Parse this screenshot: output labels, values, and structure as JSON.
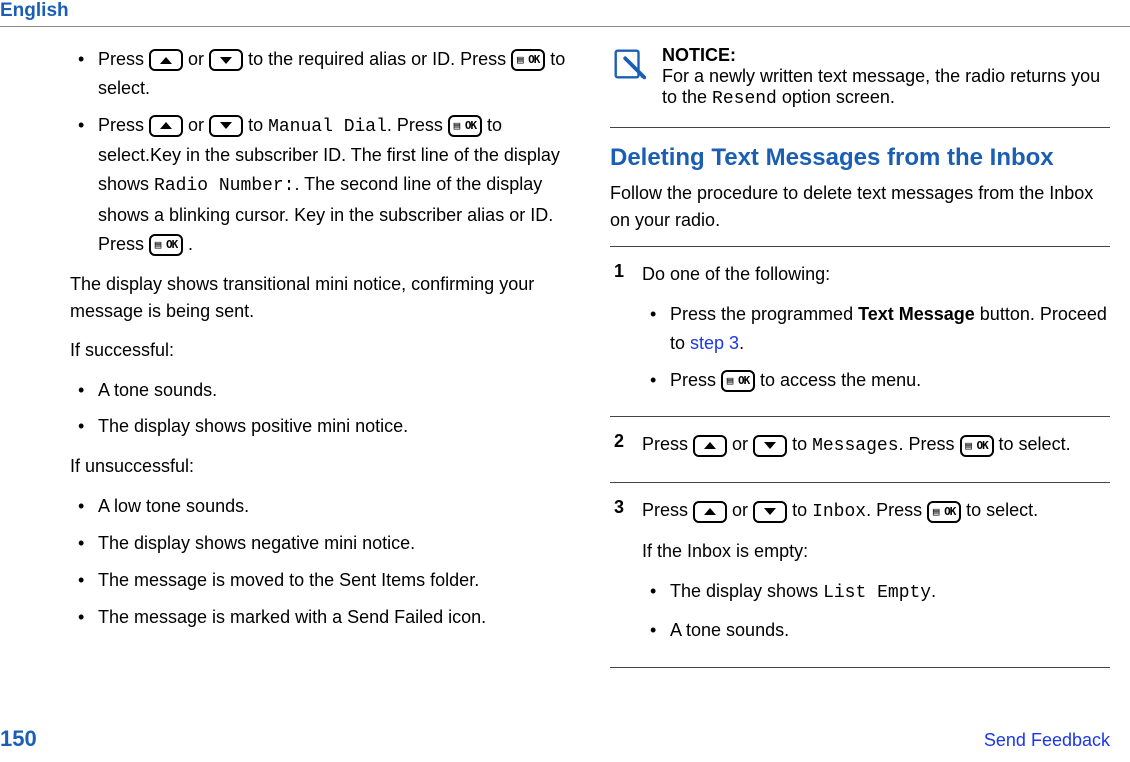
{
  "header": {
    "language": "English"
  },
  "left": {
    "bullet1_a": "Press ",
    "bullet1_b": " or ",
    "bullet1_c": " to the required alias or ID. Press ",
    "bullet1_d": " to select.",
    "bullet2_a": "Press ",
    "bullet2_b": " or ",
    "bullet2_c": " to ",
    "bullet2_mono1": "Manual Dial",
    "bullet2_d": ". Press ",
    "bullet2_e": " to select.Key in the subscriber ID. The first line of the display shows ",
    "bullet2_mono2": "Radio Number:",
    "bullet2_f": ". The second line of the display shows a blinking cursor. Key in the subscriber alias or ID. Press ",
    "bullet2_g": ".",
    "p1": "The display shows transitional mini notice, confirming your message is being sent.",
    "p2": "If successful:",
    "succ": [
      "A tone sounds.",
      "The display shows positive mini notice."
    ],
    "p3": "If unsuccessful:",
    "unsucc": [
      "A low tone sounds.",
      "The display shows negative mini notice.",
      "The message is moved to the Sent Items folder.",
      "The message is marked with a Send Failed icon."
    ]
  },
  "right": {
    "notice_title": "NOTICE:",
    "notice_body_a": "For a newly written text message, the radio returns you to the ",
    "notice_mono": "Resend",
    "notice_body_b": " option screen.",
    "section_title": "Deleting Text Messages from the Inbox",
    "section_intro": "Follow the procedure to delete text messages from the Inbox on your radio.",
    "step1_lead": "Do one of the following:",
    "step1_b1_a": "Press the programmed ",
    "step1_b1_bold": "Text Message",
    "step1_b1_b": " button. Proceed to ",
    "step1_b1_link": "step 3",
    "step1_b1_c": ".",
    "step1_b2_a": "Press ",
    "step1_b2_b": " to access the menu.",
    "step2_a": "Press ",
    "step2_b": " or ",
    "step2_c": " to ",
    "step2_mono": "Messages",
    "step2_d": ". Press ",
    "step2_e": " to select.",
    "step3_a": "Press ",
    "step3_b": " or ",
    "step3_c": " to ",
    "step3_mono": "Inbox",
    "step3_d": ". Press ",
    "step3_e": " to select.",
    "step3_p": "If the Inbox is empty:",
    "step3_li1_a": "The display shows ",
    "step3_li1_mono": "List Empty",
    "step3_li1_b": ".",
    "step3_li2": "A tone sounds."
  },
  "footer": {
    "page": "150",
    "feedback": "Send Feedback"
  },
  "ok_label": "▤ OK"
}
